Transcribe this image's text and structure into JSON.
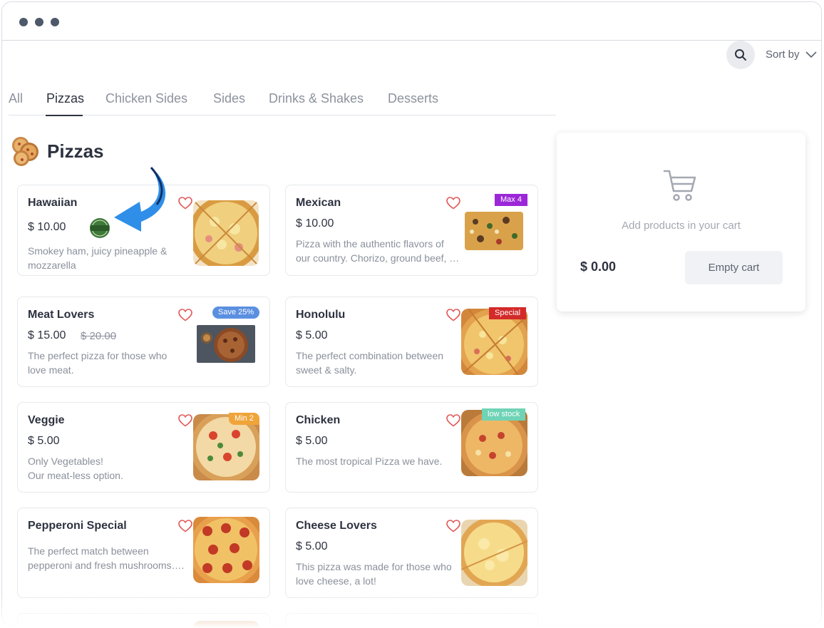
{
  "toolbar": {
    "sort_label": "Sort by"
  },
  "tabs": [
    {
      "label": "All"
    },
    {
      "label": "Pizzas",
      "active": true
    },
    {
      "label": "Chicken Sides"
    },
    {
      "label": "Sides"
    },
    {
      "label": "Drinks & Shakes"
    },
    {
      "label": "Desserts"
    }
  ],
  "section": {
    "title": "Pizzas"
  },
  "products": [
    {
      "name": "Hawaiian",
      "price": "$ 10.00",
      "description": "Smokey ham, juicy pineapple & mozzarella",
      "seal": "seal-icon"
    },
    {
      "name": "Mexican",
      "price": "$ 10.00",
      "description": "Pizza with the authentic flavors of our country. Chorizo, ground beef, …",
      "badge": "Max 4",
      "badge_color": "#9b27d8"
    },
    {
      "name": "Meat Lovers",
      "price": "$ 15.00",
      "old_price": "$ 20.00",
      "description": "The perfect pizza for those who love meat.",
      "badge": "Save 25%",
      "badge_color": "#5b8fe0"
    },
    {
      "name": "Honolulu",
      "price": "$ 5.00",
      "description": "The perfect combination between sweet & salty.",
      "badge": "Special",
      "badge_color": "#d32a2a"
    },
    {
      "name": "Veggie",
      "price": "$ 5.00",
      "description_lines": [
        "Only Vegetables!",
        "Our meat-less option."
      ],
      "badge": "Min 2",
      "badge_color": "#f0a43a"
    },
    {
      "name": "Chicken",
      "price": "$ 5.00",
      "description": "The most tropical Pizza we have.",
      "badge": "low stock",
      "badge_color": "#6fd3b5"
    },
    {
      "name": "Pepperoni Special",
      "description": "The perfect match between pepperoni and fresh mushrooms…."
    },
    {
      "name": "Cheese Lovers",
      "price": "$ 5.00",
      "description": "This pizza was made for those who love cheese, a lot!"
    }
  ],
  "cart": {
    "message": "Add products in your cart",
    "total": "$ 0.00",
    "empty_label": "Empty cart"
  },
  "colors": {
    "text": "#2d3240",
    "muted": "#8c929d",
    "heart": "#e05a5a",
    "arrow": "#2f8fe8"
  }
}
